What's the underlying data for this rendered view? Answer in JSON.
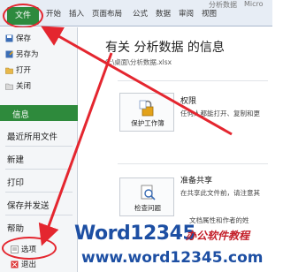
{
  "ribbon": {
    "file_tab": "文件",
    "tabs": [
      "开始",
      "插入",
      "页面布局",
      "公式",
      "数据",
      "审阅",
      "视图"
    ],
    "title_part": "分析数据",
    "title_suffix": "Micro"
  },
  "nav": {
    "save": "保存",
    "save_as": "另存为",
    "open": "打开",
    "close": "关闭",
    "info": "信息",
    "recent": "最近所用文件",
    "new": "新建",
    "print": "打印",
    "save_send": "保存并发送",
    "help": "帮助",
    "options": "选项",
    "exit": "退出"
  },
  "content": {
    "title": "有关 分析数据 的信息",
    "path": "C:\\桌面\\分析数据.xlsx",
    "permissions": {
      "heading": "权限",
      "text": "任何人都能打开、复制和更",
      "button": "保护工作簿"
    },
    "prepare": {
      "heading": "准备共享",
      "text1": "在共享此文件前，请注意其",
      "text2": "文档属性和作者的姓",
      "button": "检查问题"
    }
  },
  "watermark": {
    "word": "Word12345",
    "tag": "办公软件教程",
    "url": "www.word12345.com"
  },
  "colors": {
    "accent_green": "#2d8a3e",
    "highlight_red": "#e4262f",
    "watermark_blue": "#1d4fa3"
  }
}
